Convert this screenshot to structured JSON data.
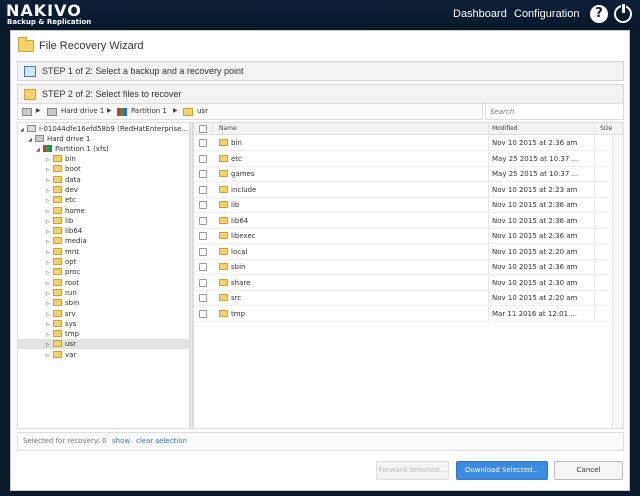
{
  "brand": {
    "name": "NAKIVO",
    "subtitle": "Backup & Replication"
  },
  "nav": {
    "dashboard": "Dashboard",
    "configuration": "Configuration",
    "help_icon": "question-circle-icon",
    "power_icon": "power-icon"
  },
  "dialog": {
    "title": "File Recovery Wizard",
    "step1": "STEP 1 of 2: Select a backup and a recovery point",
    "step2": "STEP 2 of 2: Select files to recover"
  },
  "breadcrumb": {
    "items": [
      "Hard drive 1",
      "Partition 1",
      "usr"
    ]
  },
  "search": {
    "placeholder": "Search"
  },
  "tree": {
    "root": "i-01044dfe16efd58b9 (RedHatEnterprise...",
    "drive": "Hard drive 1",
    "partition": "Partition 1 (xfs)",
    "folders": [
      "bin",
      "boot",
      "data",
      "dev",
      "etc",
      "home",
      "lib",
      "lib64",
      "media",
      "mnt",
      "opt",
      "proc",
      "root",
      "run",
      "sbin",
      "srv",
      "sys",
      "tmp",
      "usr",
      "var"
    ],
    "selected": "usr"
  },
  "list": {
    "columns": {
      "name": "Name",
      "modified": "Modified",
      "size": "Size"
    },
    "rows": [
      {
        "name": "bin",
        "modified": "Nov 10 2015 at 2:36 am",
        "size": ""
      },
      {
        "name": "etc",
        "modified": "May 25 2015 at 10:37 ...",
        "size": ""
      },
      {
        "name": "games",
        "modified": "May 25 2015 at 10:37 ...",
        "size": ""
      },
      {
        "name": "include",
        "modified": "Nov 10 2015 at 2:23 am",
        "size": ""
      },
      {
        "name": "lib",
        "modified": "Nov 10 2015 at 2:36 am",
        "size": ""
      },
      {
        "name": "lib64",
        "modified": "Nov 10 2015 at 2:36 am",
        "size": ""
      },
      {
        "name": "libexec",
        "modified": "Nov 10 2015 at 2:36 am",
        "size": ""
      },
      {
        "name": "local",
        "modified": "Nov 10 2015 at 2:20 am",
        "size": ""
      },
      {
        "name": "sbin",
        "modified": "Nov 10 2015 at 2:36 am",
        "size": ""
      },
      {
        "name": "share",
        "modified": "Nov 10 2015 at 2:30 am",
        "size": ""
      },
      {
        "name": "src",
        "modified": "Nov 10 2015 at 2:20 am",
        "size": ""
      },
      {
        "name": "tmp",
        "modified": "Mar 11 2016 at 12:01 ...",
        "size": ""
      }
    ]
  },
  "footer": {
    "selected_label": "Selected for recovery: 0",
    "show": "show",
    "clear": "clear selection"
  },
  "buttons": {
    "forward": "Forward Selected...",
    "download": "Download Selected...",
    "cancel": "Cancel"
  },
  "colors": {
    "accent": "#3b8ce0",
    "header_bg": "#0b1f36",
    "folder": "#f6d36a"
  }
}
